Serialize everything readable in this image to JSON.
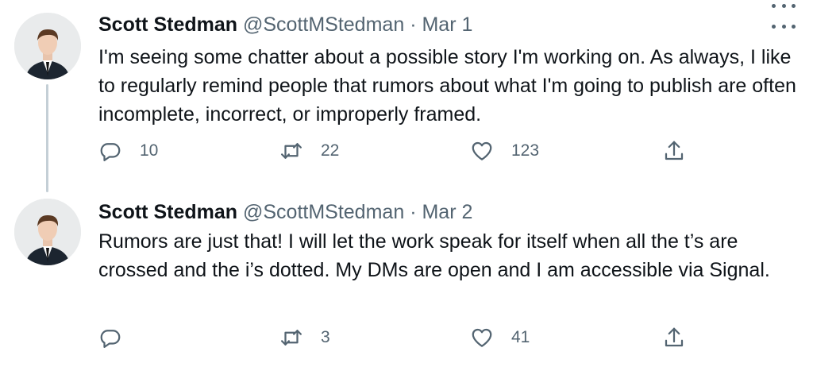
{
  "tweets": [
    {
      "author": {
        "name": "Scott Stedman",
        "handle": "@ScottMStedman",
        "avatar": "profile-photo"
      },
      "separator": "·",
      "date": "Mar 1",
      "text": "I'm seeing some chatter about a possible story I'm working on. As always, I like to regularly remind people that rumors about what I'm going to publish are often incomplete, incorrect, or improperly framed.",
      "actions": {
        "replies": "10",
        "retweets": "22",
        "likes": "123"
      },
      "icons": [
        "reply-icon",
        "retweet-icon",
        "like-icon",
        "share-icon",
        "more-options-icon"
      ]
    },
    {
      "author": {
        "name": "Scott Stedman",
        "handle": "@ScottMStedman",
        "avatar": "profile-photo"
      },
      "separator": "·",
      "date": "Mar 2",
      "text": "Rumors are just that! I will let the work speak for itself when all the t’s are crossed and the i’s dotted. My DMs are open and I am accessible via Signal.",
      "actions": {
        "replies": "",
        "retweets": "3",
        "likes": "41"
      },
      "icons": [
        "reply-icon",
        "retweet-icon",
        "like-icon",
        "share-icon",
        "more-options-icon"
      ]
    }
  ],
  "colors": {
    "text": "#0f1419",
    "secondary": "#536471",
    "thread_line": "#c4cfd6",
    "background": "#ffffff"
  }
}
